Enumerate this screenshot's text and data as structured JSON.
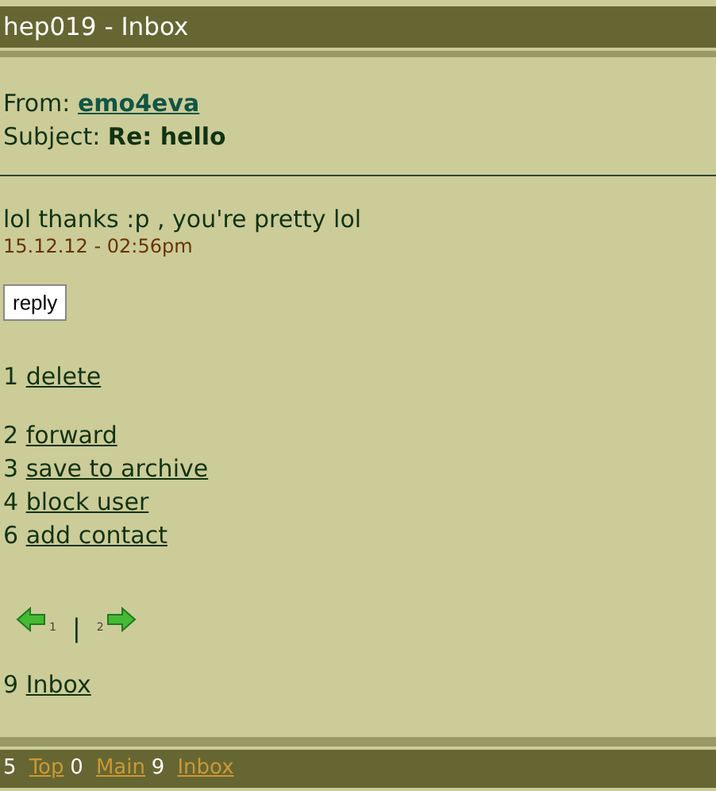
{
  "window": {
    "title": "hep019 - Inbox"
  },
  "message": {
    "from_label": "From:",
    "from": "emo4eva",
    "subject_label": "Subject:",
    "subject": "Re: hello",
    "body": "lol thanks :p , you're pretty lol",
    "date": "15.12.12 - 02:56pm"
  },
  "reply_button": "reply",
  "delete_action": {
    "key": "1",
    "label": "delete"
  },
  "actions": [
    {
      "key": "2",
      "label": "forward"
    },
    {
      "key": "3",
      "label": "save to archive"
    },
    {
      "key": "4",
      "label": "block user"
    },
    {
      "key": "6",
      "label": "add contact"
    }
  ],
  "pager": {
    "prev_key": "1",
    "separator": "|",
    "next_key": "2"
  },
  "back_link": {
    "key": "9",
    "label": "Inbox"
  },
  "footer": [
    {
      "key": "5",
      "label": "Top"
    },
    {
      "key": "0",
      "label": "Main"
    },
    {
      "key": "9",
      "label": "Inbox"
    }
  ]
}
